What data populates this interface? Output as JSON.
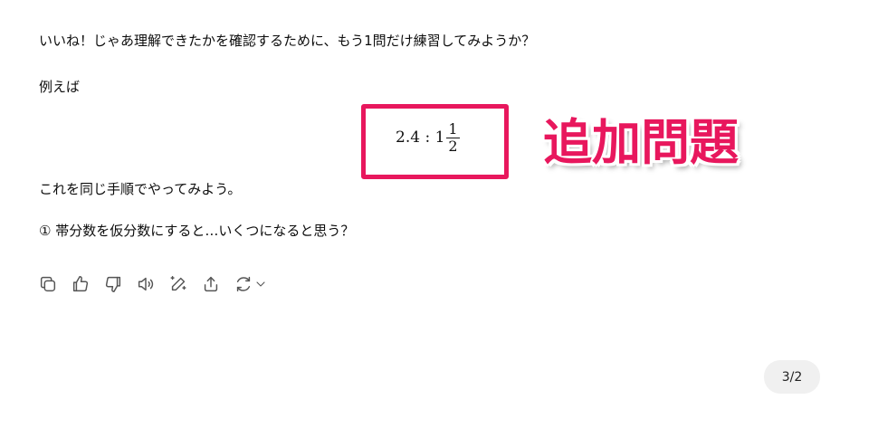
{
  "message": {
    "line1": "いいね！じゃあ理解できたかを確認するために、もう1問だけ練習してみようか？",
    "line2": "例えば",
    "math": {
      "ratio": "2.4 : 1",
      "frac_num": "1",
      "frac_den": "2"
    },
    "line3": "これを同じ手順でやってみよう。",
    "line4": "① 帯分数を仮分数にすると…いくつになると思う？"
  },
  "annotation": {
    "callout": "追加問題",
    "color": "#e8175d"
  },
  "actions": {
    "icons": [
      "copy-icon",
      "thumbs-up-icon",
      "thumbs-down-icon",
      "read-aloud-icon",
      "edit-icon",
      "share-icon",
      "regenerate-icon"
    ]
  },
  "pager": {
    "label": "3/2"
  }
}
